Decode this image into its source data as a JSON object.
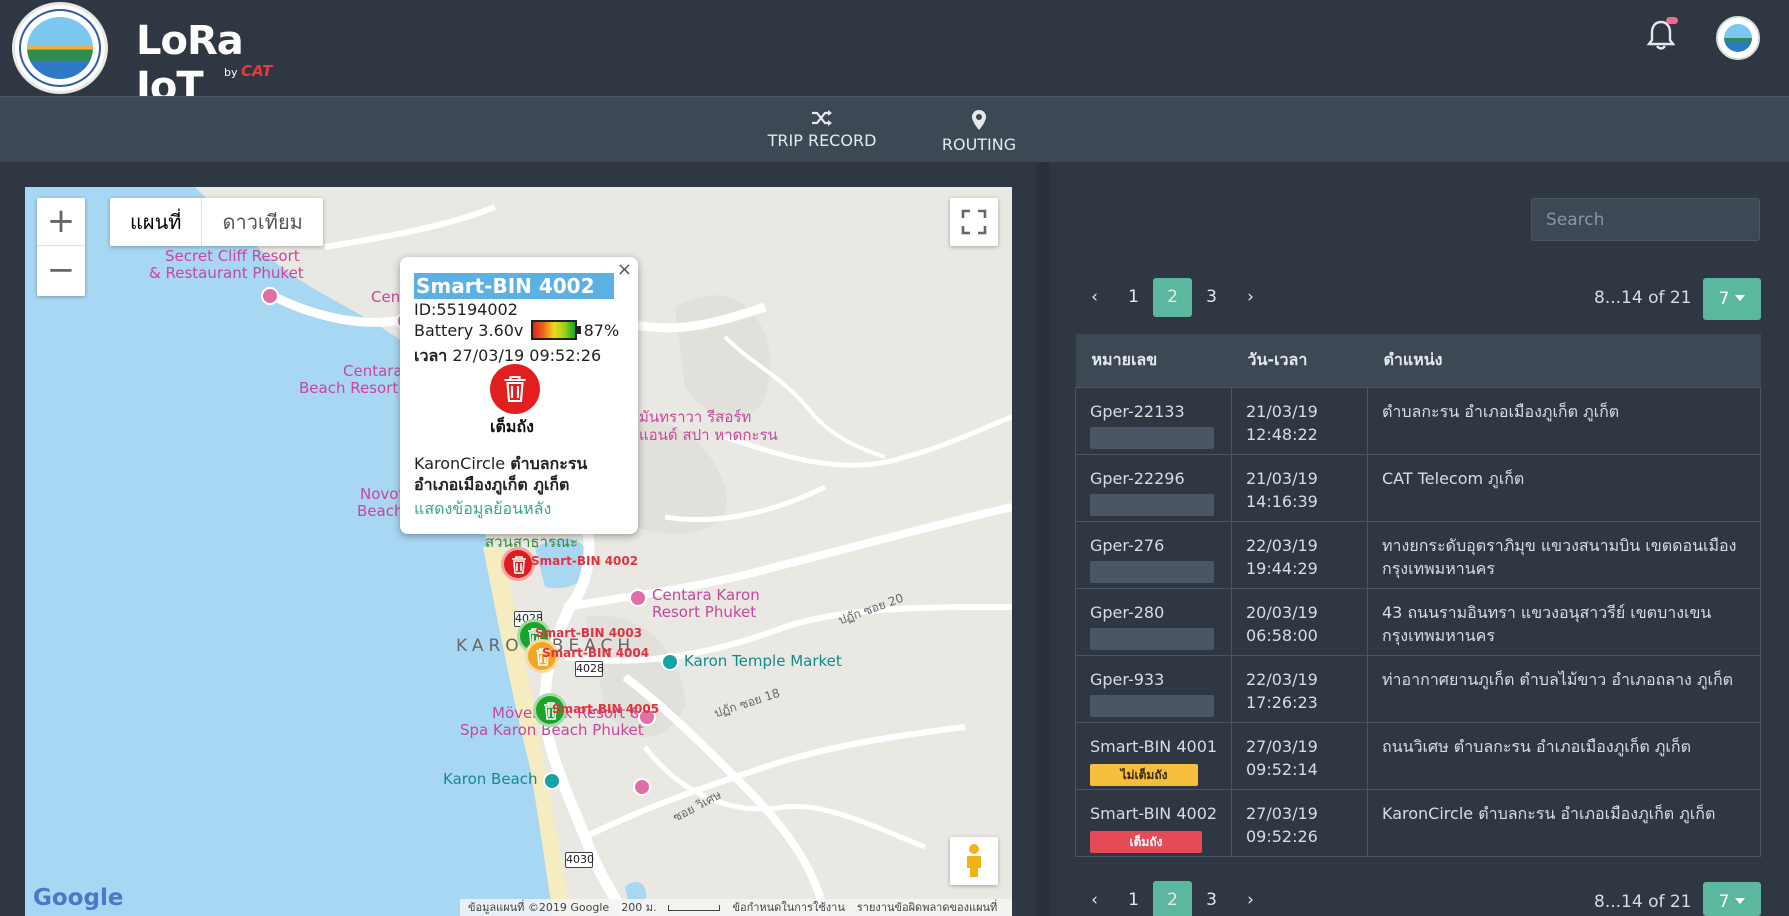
{
  "header": {
    "brand_name": "LoRa IoT",
    "brand_by": "by",
    "brand_owner": "CAT",
    "notification_icon": "bell-icon",
    "accent_color": "#5bb89e"
  },
  "nav": {
    "trip_record": "TRIP RECORD",
    "routing": "ROUTING"
  },
  "map": {
    "zoom_in": "+",
    "zoom_out": "−",
    "type_map": "แผนที่",
    "type_satellite": "ดาวเทียม",
    "google_logo": "Google",
    "footer": {
      "data": "ข้อมูลแผนที่ ©2019 Google",
      "scale": "200 ม.",
      "terms": "ข้อกำหนดในการใช้งาน",
      "report": "รายงานข้อผิดพลาดของแผนที่"
    },
    "labels": {
      "secret_cliff_1": "Secret Cliff Resort",
      "secret_cliff_2": "& Restaurant Phuket",
      "centara_cut": "Cen",
      "centara_beach_1": "Centara",
      "centara_beach_2": "Beach Resort P",
      "mantra_1": "มันทราวา รีสอร์ท",
      "mantra_2": "แอนด์ สปา หาดกะรน",
      "novotel_1": "Novot",
      "novotel_2": "Beach",
      "park": "สวนสาธารณะ",
      "centara_karon_1": "Centara Karon",
      "centara_karon_2": "Resort Phuket",
      "karon_beach_area": "KARON BEACH",
      "temple_market": "Karon Temple Market",
      "movenpick_1": "Mövenpick Resort &",
      "movenpick_2": "Spa Karon Beach Phuket",
      "karon_beach": "Karon Beach",
      "soi_20": "ปฏัก ซอย 20",
      "soi_18": "ปฏัก ซอย 18",
      "soi_vises": "ซอย วิเศษ",
      "road_4028a": "4028",
      "road_4028b": "4028",
      "road_4030": "4030"
    },
    "markers": [
      {
        "label": "Smart-BIN 4002",
        "status_color": "#de1d1d"
      },
      {
        "label": "Smart-BIN 4003",
        "status_color": "#1aa52a"
      },
      {
        "label": "Smart-BIN 4004",
        "status_color": "#f3a623"
      },
      {
        "label": "Smart-BIN 4005",
        "status_color": "#1aa52a"
      }
    ]
  },
  "popup": {
    "close": "×",
    "title": "Smart-BIN 4002",
    "id": "ID:55194002",
    "battery_label": "Battery 3.60v",
    "battery_pct": "87%",
    "battery_level": 87,
    "time_label": "เวลา",
    "time_value": "27/03/19 09:52:26",
    "status": "เต็มถัง",
    "addr_prefix": "KaronCircle",
    "addr_1": "ตำบลกะรน",
    "addr_2": "อำเภอเมืองภูเก็ต ภูเก็ต",
    "history_link": "แสดงข้อมูลย้อนหลัง"
  },
  "panel": {
    "search_placeholder": "Search",
    "pager": {
      "prev": "‹",
      "pages": [
        "1",
        "2",
        "3"
      ],
      "next": "›",
      "active": "2"
    },
    "range": "8...14 of 21",
    "per_page": "7",
    "columns": [
      "หมายเลข",
      "วัน-เวลา",
      "ตำแหน่ง"
    ],
    "rows": [
      {
        "id": "Gper-22133",
        "date": "21/03/19",
        "time": "12:48:22",
        "location": "ตำบลกะรน อำเภอเมืองภูเก็ต ภูเก็ต",
        "badge": ""
      },
      {
        "id": "Gper-22296",
        "date": "21/03/19",
        "time": "14:16:39",
        "location": "CAT Telecom ภูเก็ต",
        "badge": ""
      },
      {
        "id": "Gper-276",
        "date": "22/03/19",
        "time": "19:44:29",
        "location": "ทางยกระดับอุตราภิมุข แขวงสนามบิน เขตดอนเมือง กรุงเทพมหานคร",
        "badge": ""
      },
      {
        "id": "Gper-280",
        "date": "20/03/19",
        "time": "06:58:00",
        "location": "43 ถนนรามอินทรา แขวงอนุสาวรีย์ เขตบางเขน กรุงเทพมหานคร",
        "badge": ""
      },
      {
        "id": "Gper-933",
        "date": "22/03/19",
        "time": "17:26:23",
        "location": "ท่าอากาศยานภูเก็ต ตำบลไม้ขาว อำเภอถลาง ภูเก็ต",
        "badge": ""
      },
      {
        "id": "Smart-BIN 4001",
        "date": "27/03/19",
        "time": "09:52:14",
        "location": "ถนนวิเศษ ตำบลกะรน อำเภอเมืองภูเก็ต ภูเก็ต",
        "badge": "ไม่เต็มถัง"
      },
      {
        "id": "Smart-BIN 4002",
        "date": "27/03/19",
        "time": "09:52:26",
        "location": "KaronCircle ตำบลกะรน อำเภอเมืองภูเก็ต ภูเก็ต",
        "badge": "เต็มถัง"
      }
    ]
  }
}
